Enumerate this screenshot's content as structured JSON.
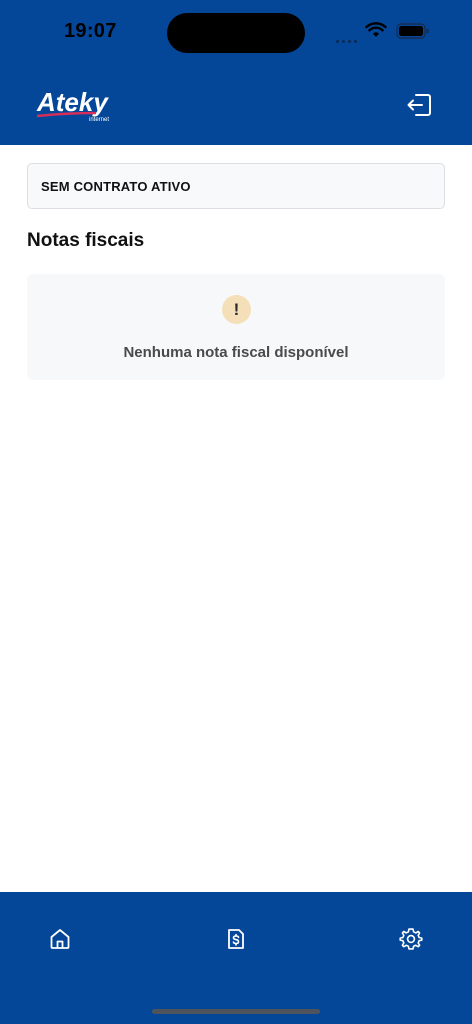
{
  "status_bar": {
    "time": "19:07"
  },
  "header": {
    "logo_text": "Ateky",
    "logo_subtext": "internet"
  },
  "contract": {
    "label": "SEM CONTRATO ATIVO"
  },
  "section": {
    "title": "Notas fiscais"
  },
  "empty_state": {
    "icon": "!",
    "message": "Nenhuma nota fiscal disponível"
  },
  "colors": {
    "brand_blue": "#044799",
    "warning_bg": "#f5dfb9"
  },
  "bottom_nav": {
    "items": [
      {
        "icon": "home-icon"
      },
      {
        "icon": "invoice-icon"
      },
      {
        "icon": "gear-icon"
      }
    ]
  }
}
